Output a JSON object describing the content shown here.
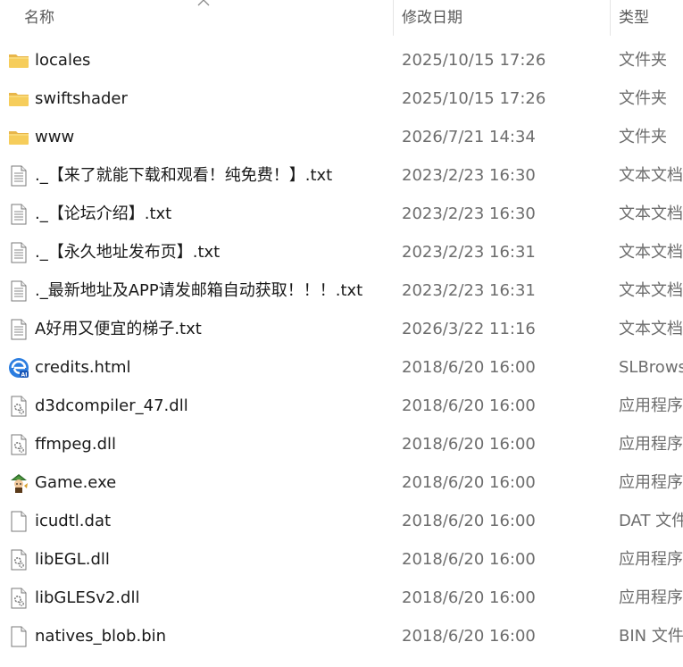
{
  "columns": {
    "name": "名称",
    "date": "修改日期",
    "type": "类型"
  },
  "files": [
    {
      "name": "locales",
      "date": "2025/10/15 17:26",
      "type": "文件夹",
      "icon": "folder-icon"
    },
    {
      "name": "swiftshader",
      "date": "2025/10/15 17:26",
      "type": "文件夹",
      "icon": "folder-icon"
    },
    {
      "name": "www",
      "date": "2026/7/21 14:34",
      "type": "文件夹",
      "icon": "folder-icon"
    },
    {
      "name": "._【来了就能下载和观看！纯免费！】.txt",
      "date": "2023/2/23 16:30",
      "type": "文本文档",
      "icon": "text-file-icon"
    },
    {
      "name": "._【论坛介绍】.txt",
      "date": "2023/2/23 16:30",
      "type": "文本文档",
      "icon": "text-file-icon"
    },
    {
      "name": "._【永久地址发布页】.txt",
      "date": "2023/2/23 16:31",
      "type": "文本文档",
      "icon": "text-file-icon"
    },
    {
      "name": "._最新地址及APP请发邮箱自动获取！！！.txt",
      "date": "2023/2/23 16:31",
      "type": "文本文档",
      "icon": "text-file-icon"
    },
    {
      "name": "A好用又便宜的梯子.txt",
      "date": "2026/3/22 11:16",
      "type": "文本文档",
      "icon": "text-file-icon"
    },
    {
      "name": "credits.html",
      "date": "2018/6/20 16:00",
      "type": "SLBrowser",
      "icon": "browser-html-icon"
    },
    {
      "name": "d3dcompiler_47.dll",
      "date": "2018/6/20 16:00",
      "type": "应用程序扩展",
      "icon": "dll-file-icon"
    },
    {
      "name": "ffmpeg.dll",
      "date": "2018/6/20 16:00",
      "type": "应用程序扩展",
      "icon": "dll-file-icon"
    },
    {
      "name": "Game.exe",
      "date": "2018/6/20 16:00",
      "type": "应用程序",
      "icon": "game-exe-icon"
    },
    {
      "name": "icudtl.dat",
      "date": "2018/6/20 16:00",
      "type": "DAT 文件",
      "icon": "blank-file-icon"
    },
    {
      "name": "libEGL.dll",
      "date": "2018/6/20 16:00",
      "type": "应用程序扩展",
      "icon": "dll-file-icon"
    },
    {
      "name": "libGLESv2.dll",
      "date": "2018/6/20 16:00",
      "type": "应用程序扩展",
      "icon": "dll-file-icon"
    },
    {
      "name": "natives_blob.bin",
      "date": "2018/6/20 16:00",
      "type": "BIN 文件",
      "icon": "blank-file-icon"
    }
  ]
}
